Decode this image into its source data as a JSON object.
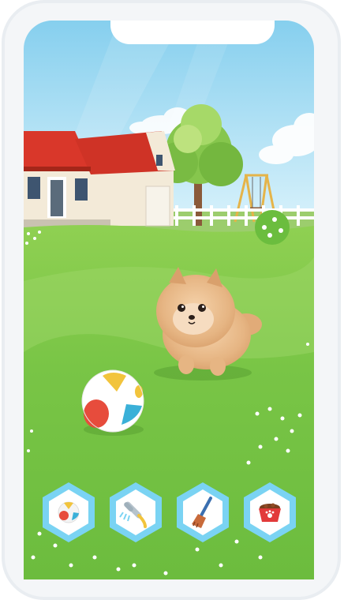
{
  "scene": {
    "name": "backyard",
    "colors": {
      "sky_top": "#8fd3f0",
      "sky_bottom": "#d8f1fb",
      "grass": "#7cc84a",
      "grass_light": "#a4d96b",
      "roof": "#d93c2c",
      "house_wall": "#f3ead8",
      "tree": "#7fc24a",
      "swing_frame": "#e6b84a",
      "fence": "#ffffff"
    }
  },
  "pet": {
    "breed": "pomeranian",
    "fur_color": "#e8b98a"
  },
  "toy": {
    "type": "beach-ball",
    "colors": [
      "#f2c43c",
      "#e74c3c",
      "#3ab0d8",
      "#ffffff"
    ]
  },
  "action_bar": {
    "buttons": [
      {
        "id": "play",
        "icon": "ball-icon"
      },
      {
        "id": "wash",
        "icon": "shower-head-icon"
      },
      {
        "id": "clean",
        "icon": "broom-icon"
      },
      {
        "id": "feed",
        "icon": "food-bowl-icon"
      }
    ],
    "button_color": "#7ad3f3",
    "button_inner": "#ffffff"
  }
}
